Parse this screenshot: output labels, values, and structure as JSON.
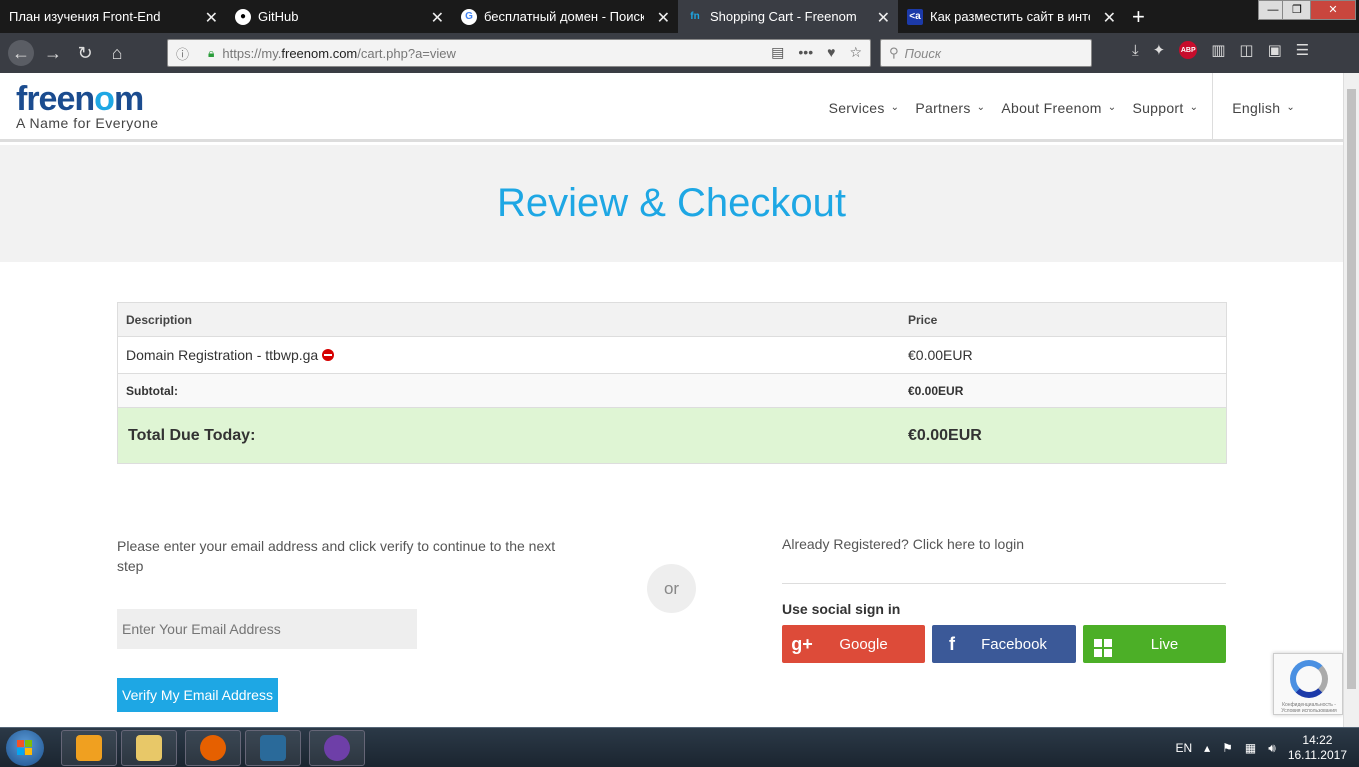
{
  "browser": {
    "tabs": [
      {
        "title": "План изучения Front-End",
        "active": false
      },
      {
        "title": "GitHub",
        "active": false
      },
      {
        "title": "бесплатный домен - Поиск в G",
        "active": false
      },
      {
        "title": "Shopping Cart - Freenom",
        "active": true
      },
      {
        "title": "Как разместить сайт в интерн",
        "active": false
      }
    ],
    "url_prefix": "https://my.",
    "url_domain": "freenom.com",
    "url_path": "/cart.php?a=view",
    "search_placeholder": "Поиск",
    "adblock_label": "ABP"
  },
  "site": {
    "logo_text_a": "free",
    "logo_text_b": "n",
    "logo_text_c": "o",
    "logo_text_d": "m",
    "tagline": "A Name for Everyone",
    "nav": [
      {
        "label": "Services"
      },
      {
        "label": "Partners"
      },
      {
        "label": "About Freenom"
      },
      {
        "label": "Support"
      }
    ],
    "language": "English"
  },
  "hero": {
    "title": "Review & Checkout"
  },
  "cart": {
    "headers": {
      "description": "Description",
      "price": "Price"
    },
    "items": [
      {
        "description": "Domain Registration - ttbwp.ga",
        "price": "€0.00EUR"
      }
    ],
    "subtotal_label": "Subtotal:",
    "subtotal_value": "€0.00EUR",
    "total_label": "Total Due Today:",
    "total_value": "€0.00EUR"
  },
  "email_section": {
    "prompt": "Please enter your email address and click verify to continue to the next step",
    "input_placeholder": "Enter Your Email Address",
    "verify_label": "Verify My Email Address"
  },
  "or_label": "or",
  "login_section": {
    "login_text": "Already Registered? Click here to login",
    "social_title": "Use social sign in",
    "google_label": "Google",
    "facebook_label": "Facebook",
    "live_label": "Live"
  },
  "recaptcha": {
    "text": "Конфиденциальность - Условия использования"
  },
  "taskbar": {
    "language": "EN",
    "time": "14:22",
    "date": "16.11.2017"
  },
  "colors": {
    "accent": "#1ea7e4",
    "brand_dark": "#1b4c8f",
    "total_bg": "#dff5d4",
    "google": "#dd4b39",
    "facebook": "#3b5998",
    "live": "#4caf27"
  }
}
